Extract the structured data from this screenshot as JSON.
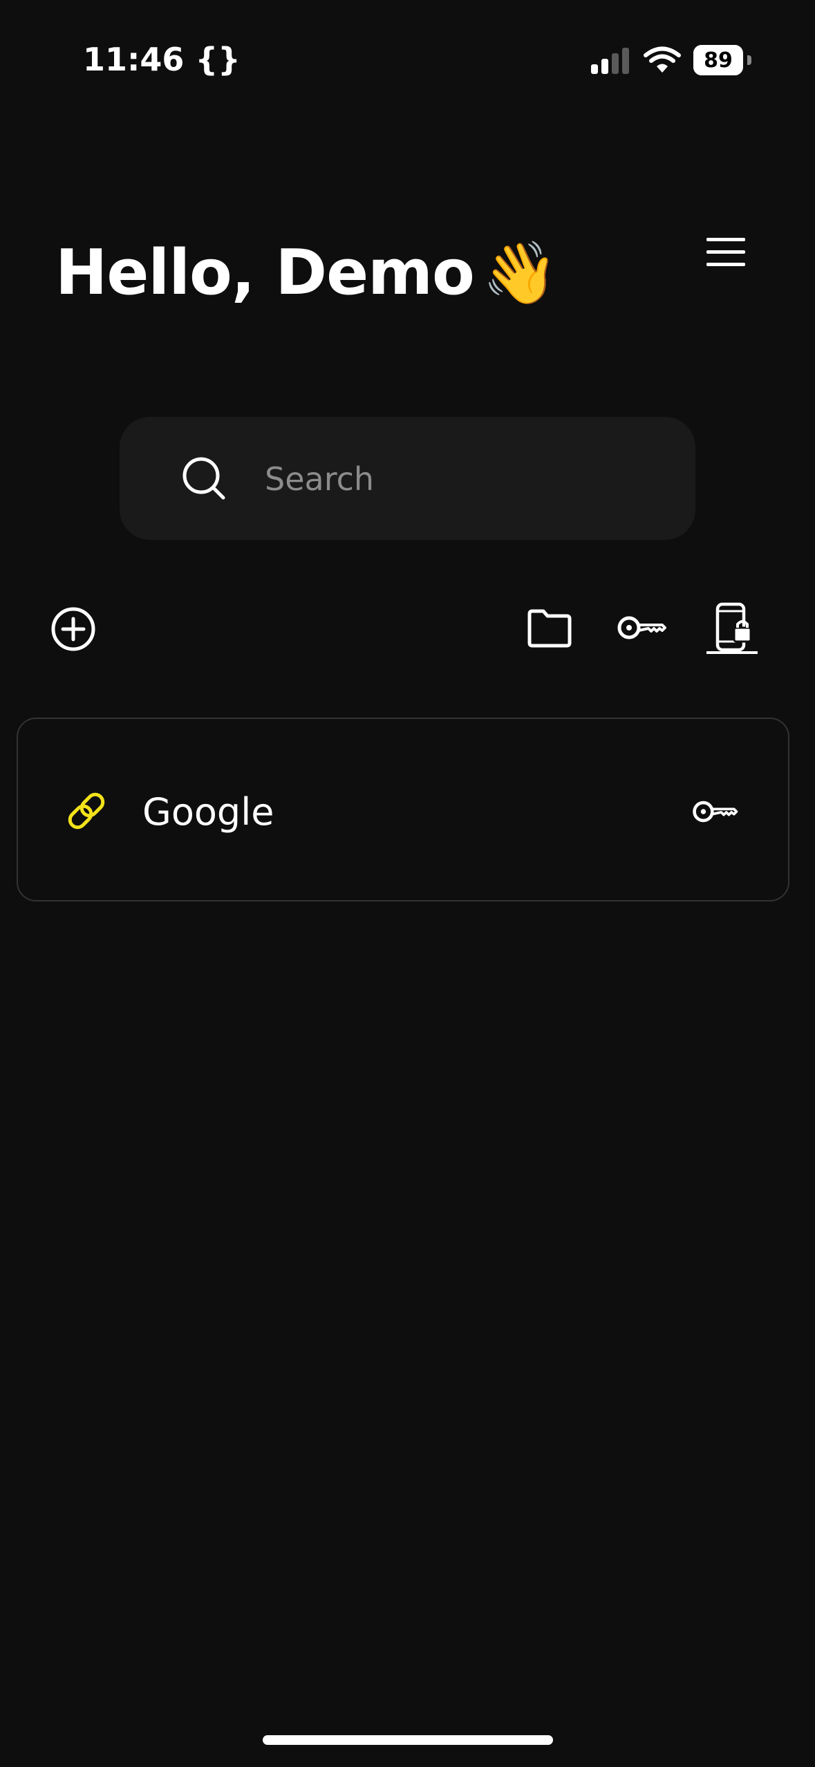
{
  "status_bar": {
    "time": "11:46 {}",
    "battery": "89",
    "battery_level": 0.89,
    "icons": [
      "cellular-signal-icon",
      "wifi-icon",
      "battery-icon"
    ]
  },
  "header": {
    "greeting": "Hello, Demo",
    "emoji": "👋",
    "menu_icon": "hamburger-menu-icon"
  },
  "search": {
    "placeholder": "Search",
    "value": "",
    "icon": "search-icon"
  },
  "toolbar": {
    "left": [
      "add-circle-icon"
    ],
    "right": [
      "folder-icon",
      "key-icon",
      "phone-lock-icon"
    ],
    "active": "phone-lock-icon"
  },
  "items": [
    {
      "title": "Google",
      "icon": "link-icon",
      "action_icon": "key-icon"
    }
  ],
  "colors": {
    "background": "#0e0e0e",
    "search_background": "#1a1a1a",
    "card_border": "#333333",
    "accent": "#f2e21a",
    "text": "#ffffff",
    "placeholder": "#8c8c8c"
  }
}
